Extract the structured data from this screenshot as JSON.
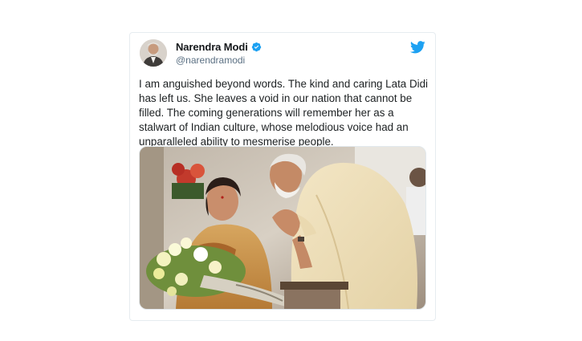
{
  "tweet": {
    "display_name": "Narendra Modi",
    "handle": "@narendramodi",
    "verified": true,
    "text": "I am anguished beyond words. The kind and caring Lata Didi has left us. She leaves a void in our nation that cannot be filled. The coming generations will remember her as a stalwart of Indian culture, whose melodious voice had an unparalleled ability to mesmerise people."
  },
  "icons": {
    "brand": "twitter-bird-icon",
    "verified": "verified-badge-icon"
  },
  "colors": {
    "twitter_blue": "#1da1f2",
    "name": "#14171a",
    "handle": "#5b7083",
    "text": "#1c2022",
    "border": "#e6ecf0"
  }
}
